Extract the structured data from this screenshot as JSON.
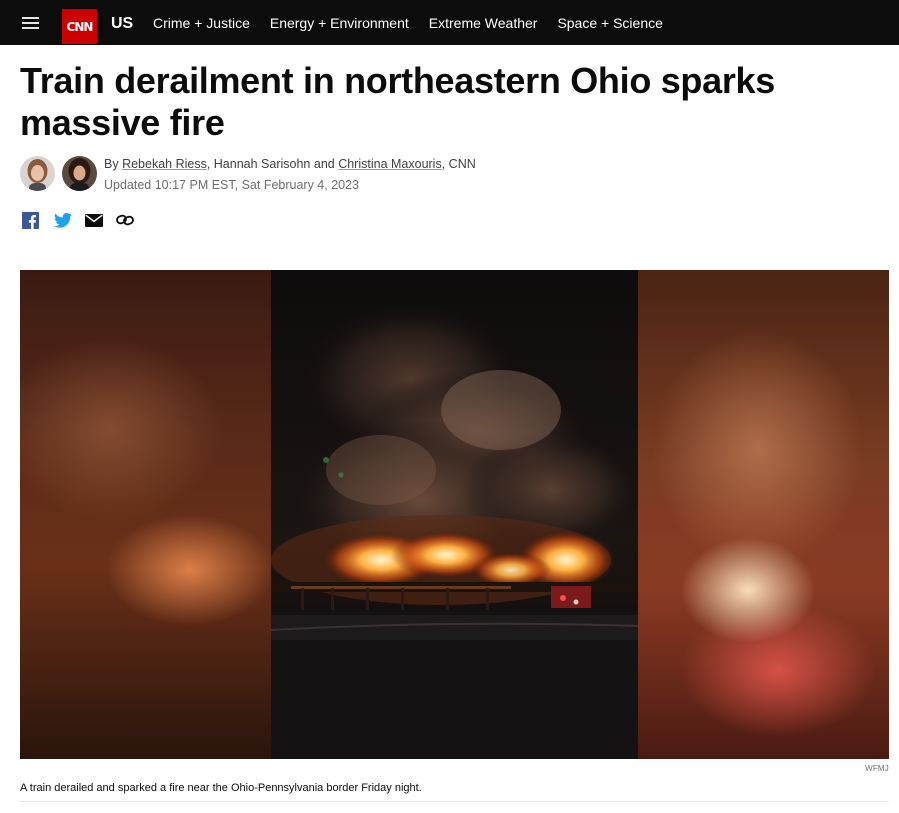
{
  "header": {
    "logo_text": "CNN",
    "section_label": "US",
    "nav_items": [
      "Crime + Justice",
      "Energy + Environment",
      "Extreme Weather",
      "Space + Science"
    ]
  },
  "article": {
    "headline": "Train derailment in northeastern Ohio sparks massive fire",
    "byline": {
      "prefix": "By ",
      "author1": "Rebekah Riess",
      "sep1": ", ",
      "author2": "Hannah Sarisohn",
      "sep2": " and ",
      "author3": "Christina Maxouris",
      "suffix": ", CNN"
    },
    "timestamp": "Updated 10:17 PM EST, Sat February 4, 2023",
    "share_icons": [
      "facebook-icon",
      "twitter-icon",
      "email-icon",
      "link-icon"
    ],
    "media": {
      "credit": "WFMJ",
      "caption": "A train derailed and sparked a fire near the Ohio-Pennsylvania border Friday night."
    }
  },
  "colors": {
    "brand_red": "#cc0000",
    "topbar_bg": "#0c0c0c",
    "facebook_blue": "#3b5998",
    "twitter_blue": "#1da1f2"
  }
}
